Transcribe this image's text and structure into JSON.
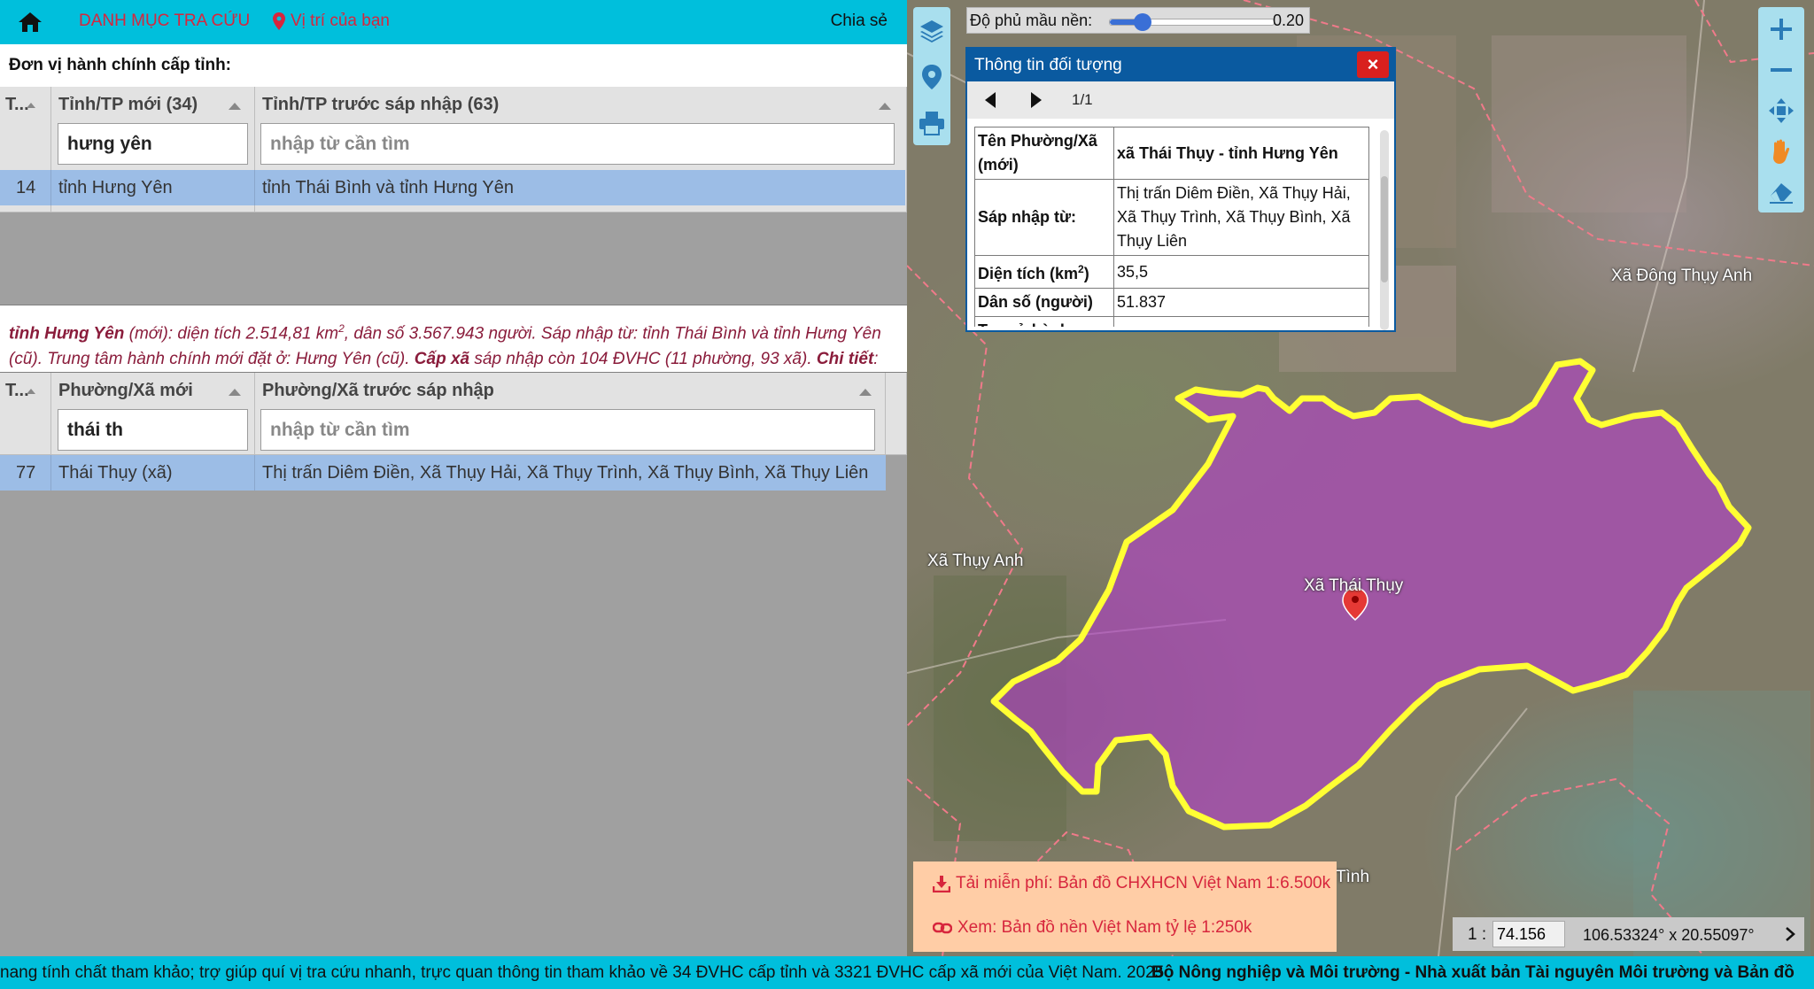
{
  "nav": {
    "category": "DANH MỤC TRA CỨU",
    "location": "Vị trí của bạn",
    "share": "Chia sẻ"
  },
  "province_section": {
    "title": "Đơn vị hành chính cấp tỉnh:",
    "columns": [
      "T...",
      "Tỉnh/TP mới (34)",
      "Tỉnh/TP trước sáp nhập (63)"
    ],
    "filter_value": "hưng yên",
    "filter_placeholder": "nhập từ cần tìm",
    "rows": [
      {
        "no": "14",
        "name": "tỉnh Hưng Yên",
        "merged": "tỉnh Thái Bình và tỉnh Hưng Yên"
      }
    ]
  },
  "province_description": {
    "name": "tỉnh Hưng Yên",
    "t1": " (mới): diện tích 2.514,81 km",
    "sup": "2",
    "t2": ", dân số 3.567.943 người. Sáp nhập từ: tỉnh Thái Bình và tỉnh Hưng Yên (cũ). Trung tâm hành chính mới đặt ở: Hưng Yên (cũ). ",
    "commune_label": "Cấp xã",
    "t3": " sáp nhập còn 104 ĐVHC (11 phường, 93 xã). ",
    "detail_label": "Chi tiết",
    "t4": ":"
  },
  "commune_section": {
    "columns": [
      "T...",
      "Phường/Xã mới",
      "Phường/Xã trước sáp nhập"
    ],
    "filter_value": "thái th",
    "filter_placeholder": "nhập từ cần tìm",
    "rows": [
      {
        "no": "77",
        "name": "Thái Thụy (xã)",
        "merged": "Thị trấn Diêm Điền, Xã Thụy Hải, Xã Thụy Trình, Xã Thụy Bình, Xã Thụy Liên"
      }
    ]
  },
  "map": {
    "opacity_label": "Độ phủ mầu nền:",
    "opacity_value": "0.20",
    "opacity_level": 0.2,
    "labels": {
      "thai_thuy": "Xã Thái Thụy",
      "thuy_anh": "Xã Thụy Anh",
      "dong_thuy_anh": "Xã Đông Thụy Anh",
      "bottom_partial": "Tình"
    },
    "left_tools": [
      "layers-icon",
      "location-pin-icon",
      "print-icon"
    ],
    "right_tools": [
      "zoom-in-icon",
      "zoom-out-icon",
      "full-extent-icon",
      "pan-hand-icon",
      "eraser-icon"
    ],
    "colors": {
      "highlight_fill": "#b23fc8",
      "boundary": "#ffff33",
      "marker": "#e53935"
    }
  },
  "popup": {
    "title": "Thông tin đối tượng",
    "close": "×",
    "counter": "1/1",
    "rows": [
      {
        "key": "Tên Phường/Xã (mới)",
        "value": "xã Thái Thụy - tỉnh Hưng Yên"
      },
      {
        "key": "Sáp nhập từ:",
        "value": "Thị trấn Diêm Điền, Xã Thụy Hải, Xã Thụy Trình, Xã Thụy Bình, Xã Thụy Liên"
      },
      {
        "key_a": "Diện tích (km",
        "key_sup": "2",
        "key_b": ")",
        "value": "35,5"
      },
      {
        "key": "Dân số (người)",
        "value": "51.837"
      },
      {
        "key": "Trụ sở hành",
        "value": ""
      }
    ]
  },
  "downloads": {
    "free": "Tải miễn phí: Bản đồ CHXHCN Việt Nam 1:6.500k",
    "view": "Xem: Bản đồ nền Việt Nam tỷ lệ 1:250k"
  },
  "scale": {
    "prefix": "1 :",
    "value": "74.156",
    "coords": "106.53324° x 20.55097°"
  },
  "ticker": {
    "text": "nang tính chất tham khảo; trợ giúp quí vị tra cứu nhanh, trực quan thông tin tham khảo về 34 ĐVHC cấp tỉnh và 3321 ĐVHC cấp xã mới của Việt Nam. 2025",
    "bold": "Bộ Nông nghiệp và Môi trường - Nhà xuất bản Tài nguyên Môi trường và Bản đồ"
  }
}
